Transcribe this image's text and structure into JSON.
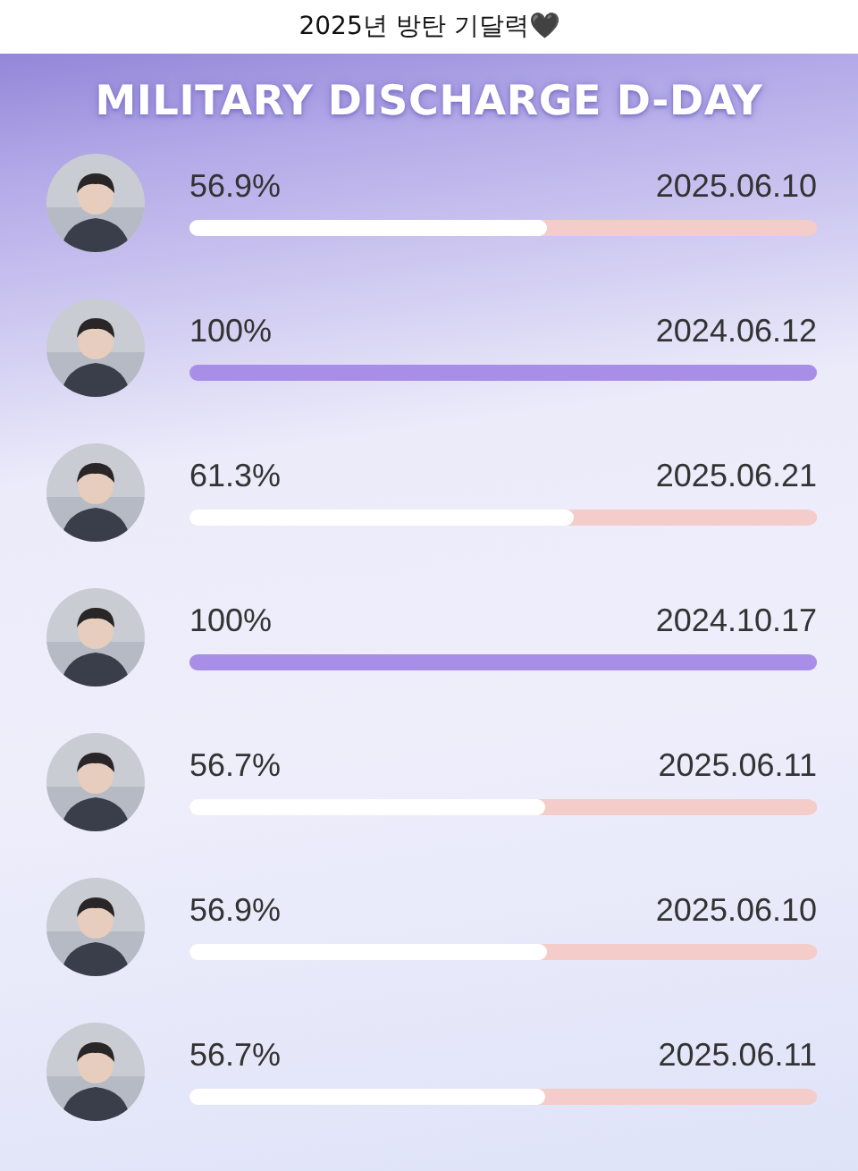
{
  "header": {
    "title": "2025년 방탄 기달력🖤"
  },
  "heading": "MILITARY DISCHARGE D-DAY",
  "members": [
    {
      "percent": "56.9%",
      "date": "2025.06.10",
      "level": 0.569
    },
    {
      "percent": "100%",
      "date": "2024.06.12",
      "level": 1
    },
    {
      "percent": "61.3%",
      "date": "2025.06.21",
      "level": 0.613
    },
    {
      "percent": "100%",
      "date": "2024.10.17",
      "level": 1
    },
    {
      "percent": "56.7%",
      "date": "2025.06.11",
      "level": 0.567
    },
    {
      "percent": "56.9%",
      "date": "2025.06.10",
      "level": 0.569
    },
    {
      "percent": "56.7%",
      "date": "2025.06.11",
      "level": 0.567
    }
  ]
}
